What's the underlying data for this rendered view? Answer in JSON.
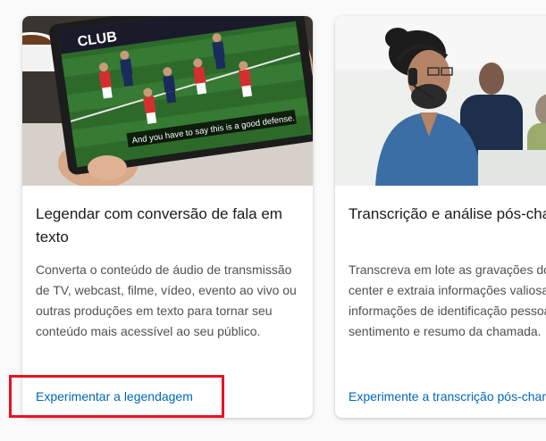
{
  "cards": [
    {
      "title": "Legendar com conversão de fala em texto",
      "description": "Converta o conteúdo de áudio de transmissão de TV, webcast, filme, vídeo, evento ao vivo ou outras produções em texto para tornar seu conteúdo mais acessível ao seu público.",
      "link_label": "Experimentar a legendagem",
      "image_caption": "And you have to say this is a good defense.",
      "image_banner_text": "CLUB"
    },
    {
      "title": "Transcrição e análise pós-chamada",
      "description_lines": [
        "Transcreva em lote as gravações do call",
        "center e extraia informações valiosas, como",
        "informações de identificação pessoal,",
        "sentimento e resumo da chamada."
      ],
      "link_label": "Experimente a transcrição pós-chamada"
    }
  ],
  "colors": {
    "link": "#0067b8",
    "highlight": "#e81123",
    "title": "#1b1b1b",
    "body": "#505050"
  }
}
